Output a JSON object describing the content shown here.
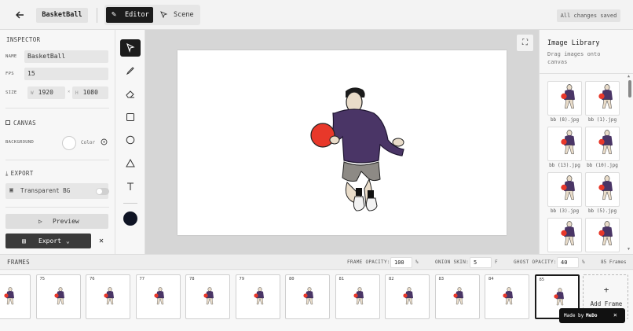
{
  "topbar": {
    "project_name": "BasketBall",
    "modes": {
      "editor": "Editor",
      "scene": "Scene"
    },
    "status": "All changes saved"
  },
  "inspector": {
    "title": "INSPECTOR",
    "name_label": "NAME",
    "name_value": "BasketBall",
    "fps_label": "FPS",
    "fps_value": "15",
    "size_label": "SIZE",
    "width_prefix": "W",
    "width_value": "1920",
    "size_sep": "×",
    "height_prefix": "H",
    "height_value": "1080",
    "canvas_title": "CANVAS",
    "background_label": "BACKGROUND",
    "color_label": "Color",
    "background_color": "#ffffff",
    "export_title": "EXPORT",
    "transparent_label": "Transparent BG",
    "transparent_on": false,
    "preview_label": "Preview",
    "export_label": "Export"
  },
  "tools": {
    "items": [
      "select",
      "brush",
      "eraser",
      "rectangle",
      "ellipse",
      "triangle",
      "text"
    ],
    "active": "select",
    "current_color": "#0f1424"
  },
  "library": {
    "title": "Image Library",
    "subtitle": "Drag images onto canvas",
    "items": [
      {
        "name": "bb (8).jpg"
      },
      {
        "name": "bb (1).jpg"
      },
      {
        "name": "bb (13).jpg"
      },
      {
        "name": "bb (10).jpg"
      },
      {
        "name": "bb (3).jpg"
      },
      {
        "name": "bb (5).jpg"
      },
      {
        "name": ""
      },
      {
        "name": ""
      }
    ]
  },
  "frames_bar": {
    "title": "FRAMES",
    "opacity_label": "FRAME OPACITY:",
    "opacity_value": "100",
    "opacity_unit": "%",
    "onion_label": "ONION SKIN:",
    "onion_value": "5",
    "onion_unit": "F",
    "ghost_label": "GHOST OPACITY:",
    "ghost_value": "40",
    "ghost_unit": "%",
    "count": "85 Frames"
  },
  "frames": {
    "items": [
      "",
      "75",
      "76",
      "77",
      "78",
      "79",
      "80",
      "81",
      "82",
      "83",
      "84",
      "85"
    ],
    "selected": "85",
    "add_label": "Add Frame",
    "add_plus": "+"
  },
  "madeby": {
    "label": "Made by",
    "brand": "MeDo"
  },
  "colors": {
    "ball": "#e8382a",
    "hoodie": "#4a3566",
    "skin": "#e9dcc9"
  }
}
